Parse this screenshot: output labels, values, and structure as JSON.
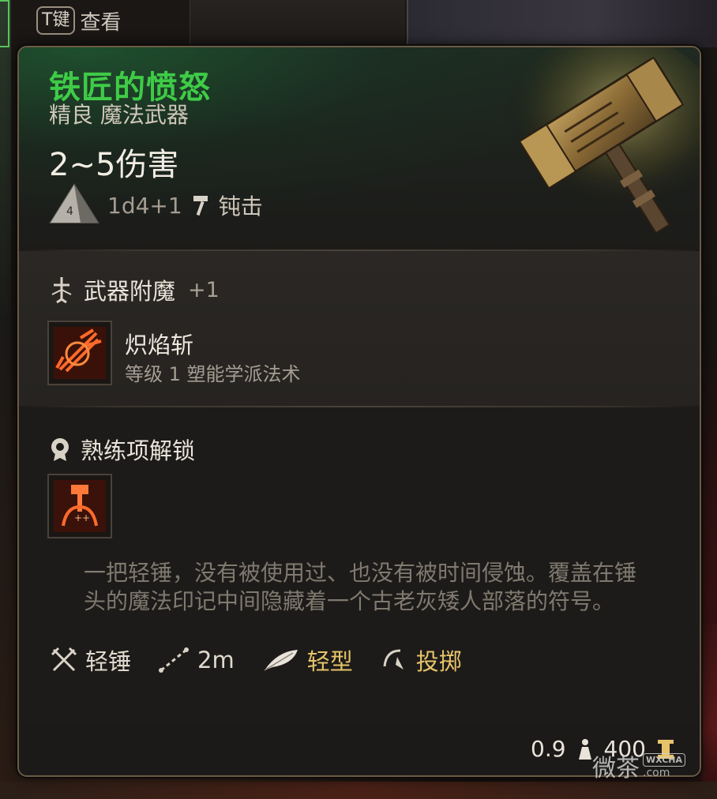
{
  "hint": {
    "key": "T键",
    "label": "查看"
  },
  "item": {
    "name": "铁匠的愤怒",
    "rarity_type": "精良 魔法武器",
    "damage": "2~5伤害",
    "dice": "1d4+1",
    "damage_type": "钝击"
  },
  "enchant": {
    "title": "武器附魔",
    "bonus": "+1",
    "spell_name": "炽焰斩",
    "spell_sub": "等级 1 塑能学派法术"
  },
  "proficiency": {
    "title": "熟练项解锁"
  },
  "description": "一把轻锤，没有被使用过、也没有被时间侵蚀。覆盖在锤头的魔法印记中间隐藏着一个古老灰矮人部落的符号。",
  "properties": [
    {
      "icon": "crossed-weapons-icon",
      "label": "轻锤"
    },
    {
      "icon": "range-icon",
      "label": "2m"
    },
    {
      "icon": "feather-icon",
      "label": "轻型"
    },
    {
      "icon": "throw-icon",
      "label": "投掷"
    }
  ],
  "footer": {
    "weight": "0.9",
    "price": "400"
  },
  "watermark": {
    "text": "微茶",
    "badge": "WXCHA",
    "sub": ".com"
  },
  "colors": {
    "name": "#3fcb47",
    "gold": "#e7c46a",
    "border": "#6a5a44"
  }
}
